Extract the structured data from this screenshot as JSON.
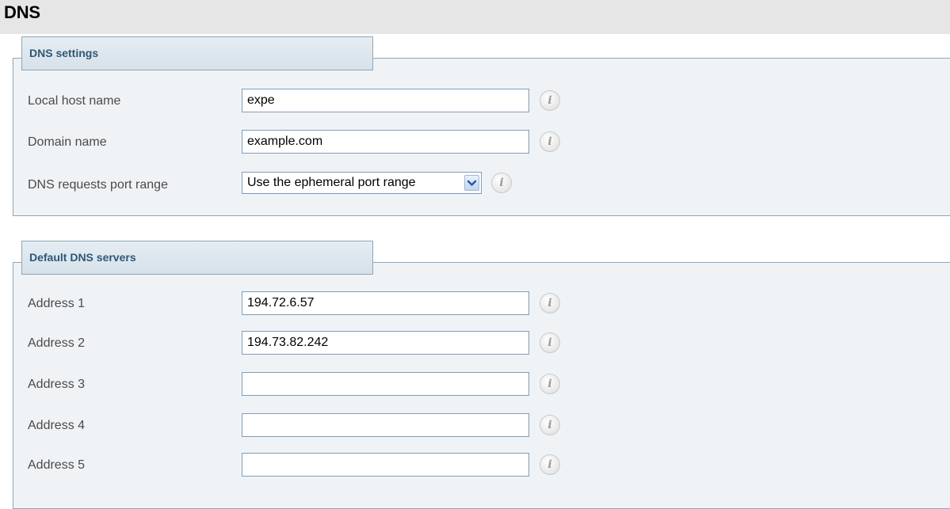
{
  "page": {
    "title": "DNS"
  },
  "dns_settings": {
    "heading": "DNS settings",
    "local_host_name": {
      "label": "Local host name",
      "value": "expe"
    },
    "domain_name": {
      "label": "Domain name",
      "value": "example.com"
    },
    "port_range": {
      "label": "DNS requests port range",
      "selected": "Use the ephemeral port range"
    }
  },
  "dns_servers": {
    "heading": "Default DNS servers",
    "addresses": [
      {
        "label": "Address 1",
        "value": "194.72.6.57"
      },
      {
        "label": "Address 2",
        "value": "194.73.82.242"
      },
      {
        "label": "Address 3",
        "value": ""
      },
      {
        "label": "Address 4",
        "value": ""
      },
      {
        "label": "Address 5",
        "value": ""
      }
    ]
  },
  "icons": {
    "info": "info-icon",
    "dropdown": "chevron-down-icon"
  },
  "info_glyph": "i"
}
